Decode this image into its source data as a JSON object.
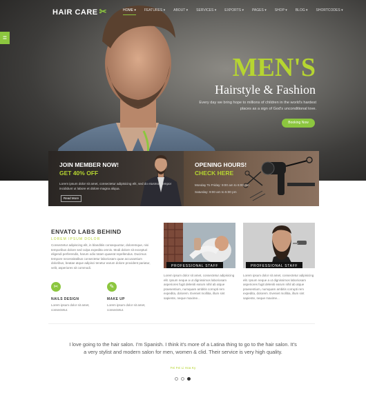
{
  "brand": {
    "name": "HAIR CARE"
  },
  "nav": {
    "items": [
      "HOME ▾",
      "FEATURES ▾",
      "ABOUT ▾",
      "SERVICES ▾",
      "EXPORTS ▾",
      "PAGES ▾",
      "SHOP ▾",
      "BLOG ▾",
      "SHORTCODES ▾"
    ]
  },
  "hero": {
    "title": "MEN'S",
    "subtitle": "Hairstyle & Fashion",
    "text": "Every day we bring hope to millions of children in the world's hardest places as a sign of God's unconditional love.",
    "button": "Booking Now"
  },
  "member_card": {
    "title": "JOIN MEMBER NOW!",
    "subtitle": "GET 40% OFF",
    "text": "Lorem ipsum dolor sit amet, consectetur adipisicing elit, sed do eiusmod tempor incididunt ut labore et dolore magna aliqua.",
    "button": "Read More"
  },
  "hours_card": {
    "title": "OPENING HOURS!",
    "subtitle": "CHECK HERE",
    "line1": "Monday To Friday: 9:00 am to 6:00 pm",
    "line2": "Saturday: 9:00 am to 5:00 pm"
  },
  "about": {
    "title": "ENVATO LABS BEHIND",
    "subtitle": "LOREM IPSUM DOLOR",
    "text": "Consectetur adipiscing elit, in blanditiis consequuntur, doloremque, nisi temporibus dolore sed culpa expedita omnis. Modi dolore sit excepturi eligendi perferendis, harum odio totam quaerat repellendus. Ducimus tempore necessitatibus consectetur laboriosam quae accusantium doloribus, beatae atque adipisci tenetur earum dolore provident pariatur, velit, asperiores sit commodi."
  },
  "features": [
    {
      "icon": "scissors-icon",
      "glyph": "✂",
      "title": "NAILS DESIGN",
      "text": "Lorem ipsum dolor sit amet, consectetur."
    },
    {
      "icon": "comb-icon",
      "glyph": "✎",
      "title": "MAKE UP",
      "text": "Lorem ipsum dolor sit amet, consectetur."
    }
  ],
  "staff": [
    {
      "tag": "PROFESSIONAL STAFF",
      "text": "Lorem ipsum dolor sit amet, consectetur adipisicing elit. Ipsum neque a ut dignissimos laboriosam asperiores fugit deleniti earum nihil ab atque praesentium, numquam ambitis corrupti rem expedita, dolorem. Eveniet mollitia, illum sint sapiente, neque maxime..."
    },
    {
      "tag": "PROFESSIONAL STAFF",
      "text": "Lorem ipsum dolor sit amet, consectetur adipisicing elit. Ipsum neque a ut dignissimos laboriosam asperiores fugit deleniti earum nihil ab atque praesentium, numquam ambitis corrupti rem expedita, dolorem. Eveniet mollitia, illum sint sapiente, neque maxime..."
    }
  ],
  "testimonial": {
    "quote": "I love going to the hair salon. I'm Spanish. I think it's more of a Latina thing to go to the hair salon. It's a very stylist and modern salon for men, women & clid. Their service is very high quality.",
    "author": "Fei Fei Li Hoa Ky"
  },
  "colors": {
    "accent": "#8cc63f",
    "accent_text": "#b6d531"
  }
}
